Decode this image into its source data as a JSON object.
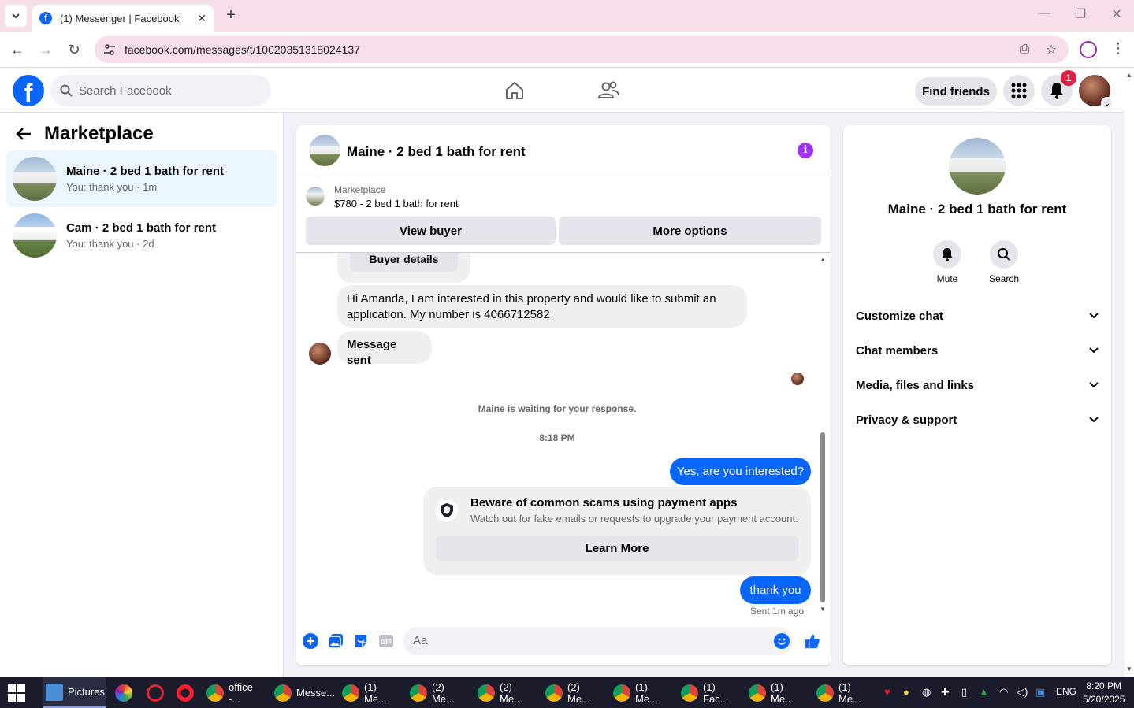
{
  "browser": {
    "tab_title": "(1) Messenger | Facebook",
    "url": "facebook.com/messages/t/10020351318024137"
  },
  "fb_header": {
    "search_placeholder": "Search Facebook",
    "find_friends_label": "Find friends",
    "notification_count": "1"
  },
  "sidebar": {
    "title": "Marketplace",
    "conversations": [
      {
        "name": "Maine · 2 bed 1 bath for rent",
        "preview": "You: thank you · 1m",
        "active": true
      },
      {
        "name": "Cam · 2 bed 1 bath for rent",
        "preview": "You: thank you · 2d",
        "active": false
      }
    ]
  },
  "chat": {
    "title": "Maine · 2 bed 1 bath for rent",
    "listing": {
      "kind": "Marketplace",
      "price_title": "$780 - 2 bed 1 bath for rent",
      "view_buyer_label": "View buyer",
      "more_options_label": "More options"
    },
    "messages": {
      "buyer_details_label": "Buyer details",
      "msg1": "Hi Amanda, I am interested in this property and would like to submit an application. My number is 4066712582",
      "msg2": "Message sent",
      "waiting_notice": "Maine is waiting for your response.",
      "timestamp": "8:18 PM",
      "out1": "Yes, are you interested?",
      "out2": "thank you",
      "sent_status": "Sent 1m ago"
    },
    "scam_notice": {
      "title": "Beware of common scams using payment apps",
      "desc": "Watch out for fake emails or requests to upgrade your payment account.",
      "button": "Learn More"
    },
    "composer_placeholder": "Aa"
  },
  "details": {
    "name": "Maine · 2 bed 1 bath for rent",
    "actions": [
      "Mute",
      "Search"
    ],
    "sections": [
      "Customize chat",
      "Chat members",
      "Media, files and links",
      "Privacy & support"
    ]
  },
  "taskbar": {
    "items": [
      "Pictures",
      "office -...",
      "Messe...",
      "(1) Me...",
      "(2) Me...",
      "(2) Me...",
      "(2) Me...",
      "(1) Me...",
      "(1) Fac...",
      "(1) Me...",
      "(1) Me..."
    ],
    "language": "ENG",
    "time": "8:20 PM",
    "date": "5/20/2025"
  },
  "colors": {
    "fb_blue": "#0866ff",
    "info_purple": "#a033ff",
    "notification_red": "#e41e3f"
  }
}
